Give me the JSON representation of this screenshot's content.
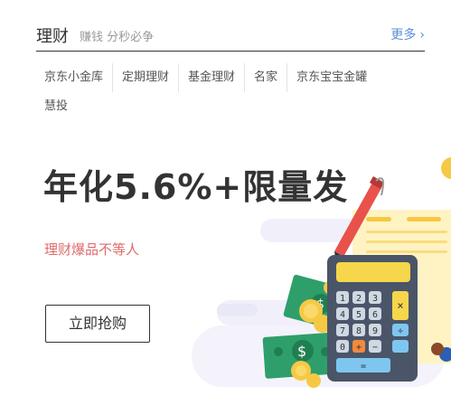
{
  "header": {
    "title": "理财",
    "subtitle": "赚钱 分秒必争",
    "more_label": "更多",
    "more_icon": "chevron-right-icon"
  },
  "categories": [
    "京东小金库",
    "定期理财",
    "基金理财",
    "名家",
    "京东宝宝金罐",
    "慧投"
  ],
  "promo": {
    "headline": "年化5.6%+限量发",
    "tagline": "理财爆品不等人",
    "button_label": "立即抢购"
  },
  "calculator": {
    "keys": [
      "1",
      "2",
      "3",
      "4",
      "5",
      "6",
      "7",
      "8",
      "9",
      "0",
      "+",
      "−"
    ],
    "op_keys": [
      "×",
      "÷",
      "="
    ]
  },
  "colors": {
    "accent_red": "#e06a6a",
    "link_blue": "#5b8fd6",
    "calculator_body": "#4a5568",
    "paper_yellow": "#fff3c4",
    "money_green": "#2e9f6b",
    "coin_gold": "#f6c945"
  }
}
